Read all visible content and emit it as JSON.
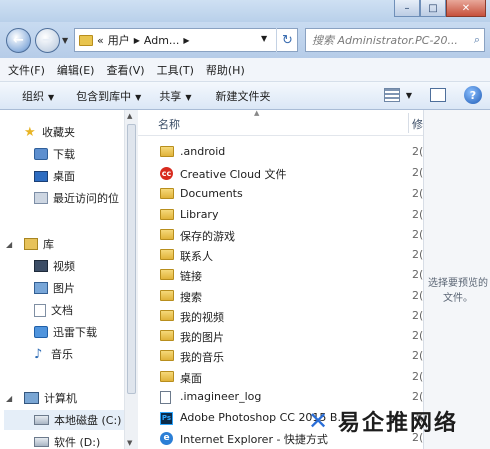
{
  "window": {
    "caption": {
      "min": "–",
      "max": "□",
      "close": "✕"
    }
  },
  "address": {
    "path_prefix": "«",
    "segments": [
      "用户",
      "Adm..."
    ],
    "search_placeholder": "搜索 Administrator.PC-20..."
  },
  "menu": [
    "文件(F)",
    "编辑(E)",
    "查看(V)",
    "工具(T)",
    "帮助(H)"
  ],
  "toolbar": {
    "organize": "组织",
    "include_in_library": "包含到库中",
    "share": "共享",
    "new_folder": "新建文件夹"
  },
  "nav": {
    "favorites": "收藏夹",
    "downloads": "下载",
    "desktop": "桌面",
    "recent": "最近访问的位",
    "libraries": "库",
    "videos": "视频",
    "pictures": "图片",
    "documents": "文档",
    "xunlei": "迅雷下载",
    "music": "音乐",
    "computer": "计算机",
    "local_disk_c": "本地磁盘 (C:)",
    "software_d": "软件 (D:)"
  },
  "columns": {
    "name": "名称",
    "modified": "修"
  },
  "files": [
    {
      "name": ".android",
      "icon": "folder-icon",
      "mod": "2("
    },
    {
      "name": "Creative Cloud 文件",
      "icon": "creative-cloud-icon",
      "mod": "2("
    },
    {
      "name": "Documents",
      "icon": "folder-icon",
      "mod": "2("
    },
    {
      "name": "Library",
      "icon": "folder-icon",
      "mod": "2("
    },
    {
      "name": "保存的游戏",
      "icon": "folder-icon",
      "mod": "2("
    },
    {
      "name": "联系人",
      "icon": "folder-icon",
      "mod": "2("
    },
    {
      "name": "链接",
      "icon": "folder-icon",
      "mod": "2("
    },
    {
      "name": "搜索",
      "icon": "folder-icon",
      "mod": "2("
    },
    {
      "name": "我的视频",
      "icon": "folder-icon",
      "mod": "2("
    },
    {
      "name": "我的图片",
      "icon": "folder-icon",
      "mod": "2("
    },
    {
      "name": "我的音乐",
      "icon": "folder-icon",
      "mod": "2("
    },
    {
      "name": "桌面",
      "icon": "folder-icon",
      "mod": "2("
    },
    {
      "name": ".imagineer_log",
      "icon": "text-file-icon",
      "mod": "2("
    },
    {
      "name": "Adobe Photoshop CC 2015 B...",
      "icon": "photoshop-icon",
      "mod": "2("
    },
    {
      "name": "Internet Explorer - 快捷方式",
      "icon": "ie-icon",
      "mod": "2("
    }
  ],
  "preview": {
    "text": "选择要预览的文件。"
  },
  "watermark": {
    "text": "易企推网络"
  }
}
